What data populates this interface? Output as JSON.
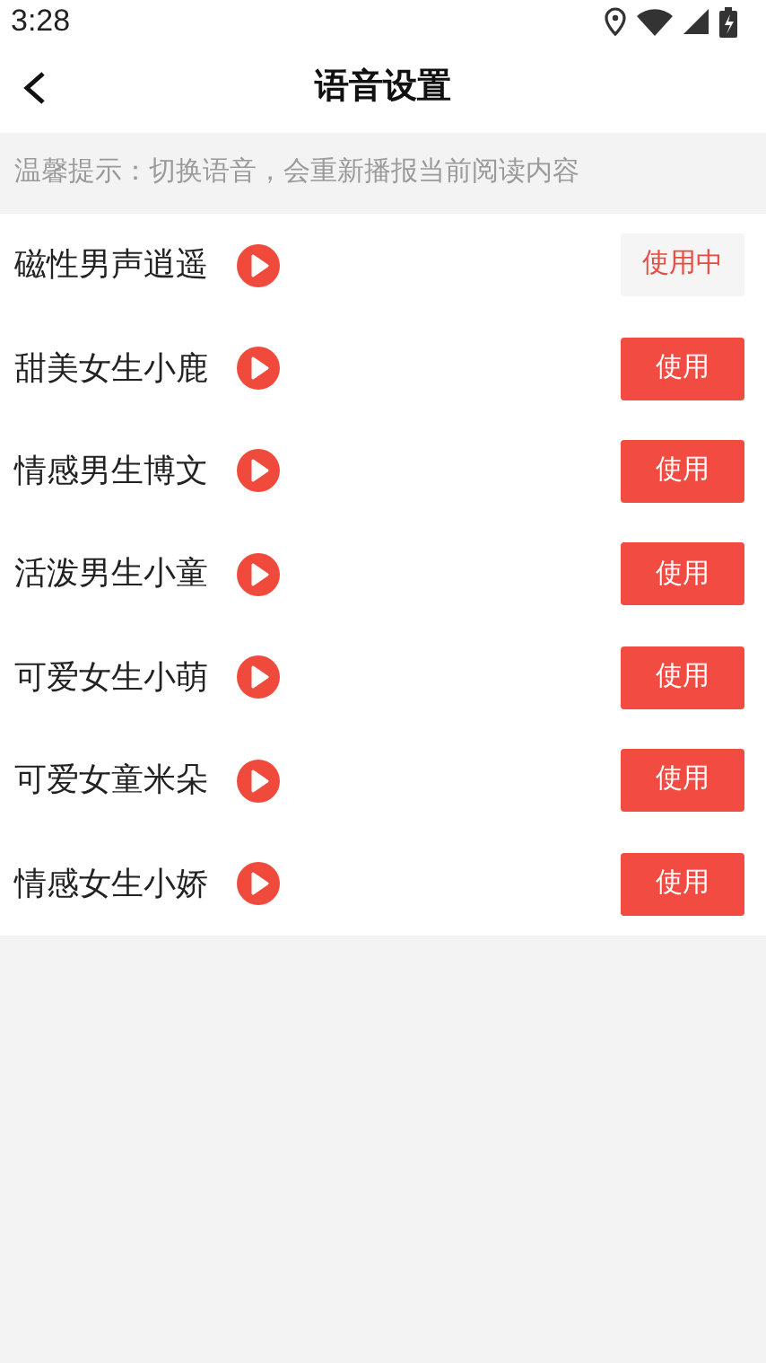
{
  "status_bar": {
    "time": "3:28"
  },
  "header": {
    "title": "语音设置"
  },
  "tip": "温馨提示：切换语音，会重新播报当前阅读内容",
  "voices": [
    {
      "name": "磁性男声逍遥",
      "button": "使用中",
      "selected": true
    },
    {
      "name": "甜美女生小鹿",
      "button": "使用",
      "selected": false
    },
    {
      "name": "情感男生博文",
      "button": "使用",
      "selected": false
    },
    {
      "name": "活泼男生小童",
      "button": "使用",
      "selected": false
    },
    {
      "name": "可爱女生小萌",
      "button": "使用",
      "selected": false
    },
    {
      "name": "可爱女童米朵",
      "button": "使用",
      "selected": false
    },
    {
      "name": "情感女生小娇",
      "button": "使用",
      "selected": false
    }
  ]
}
